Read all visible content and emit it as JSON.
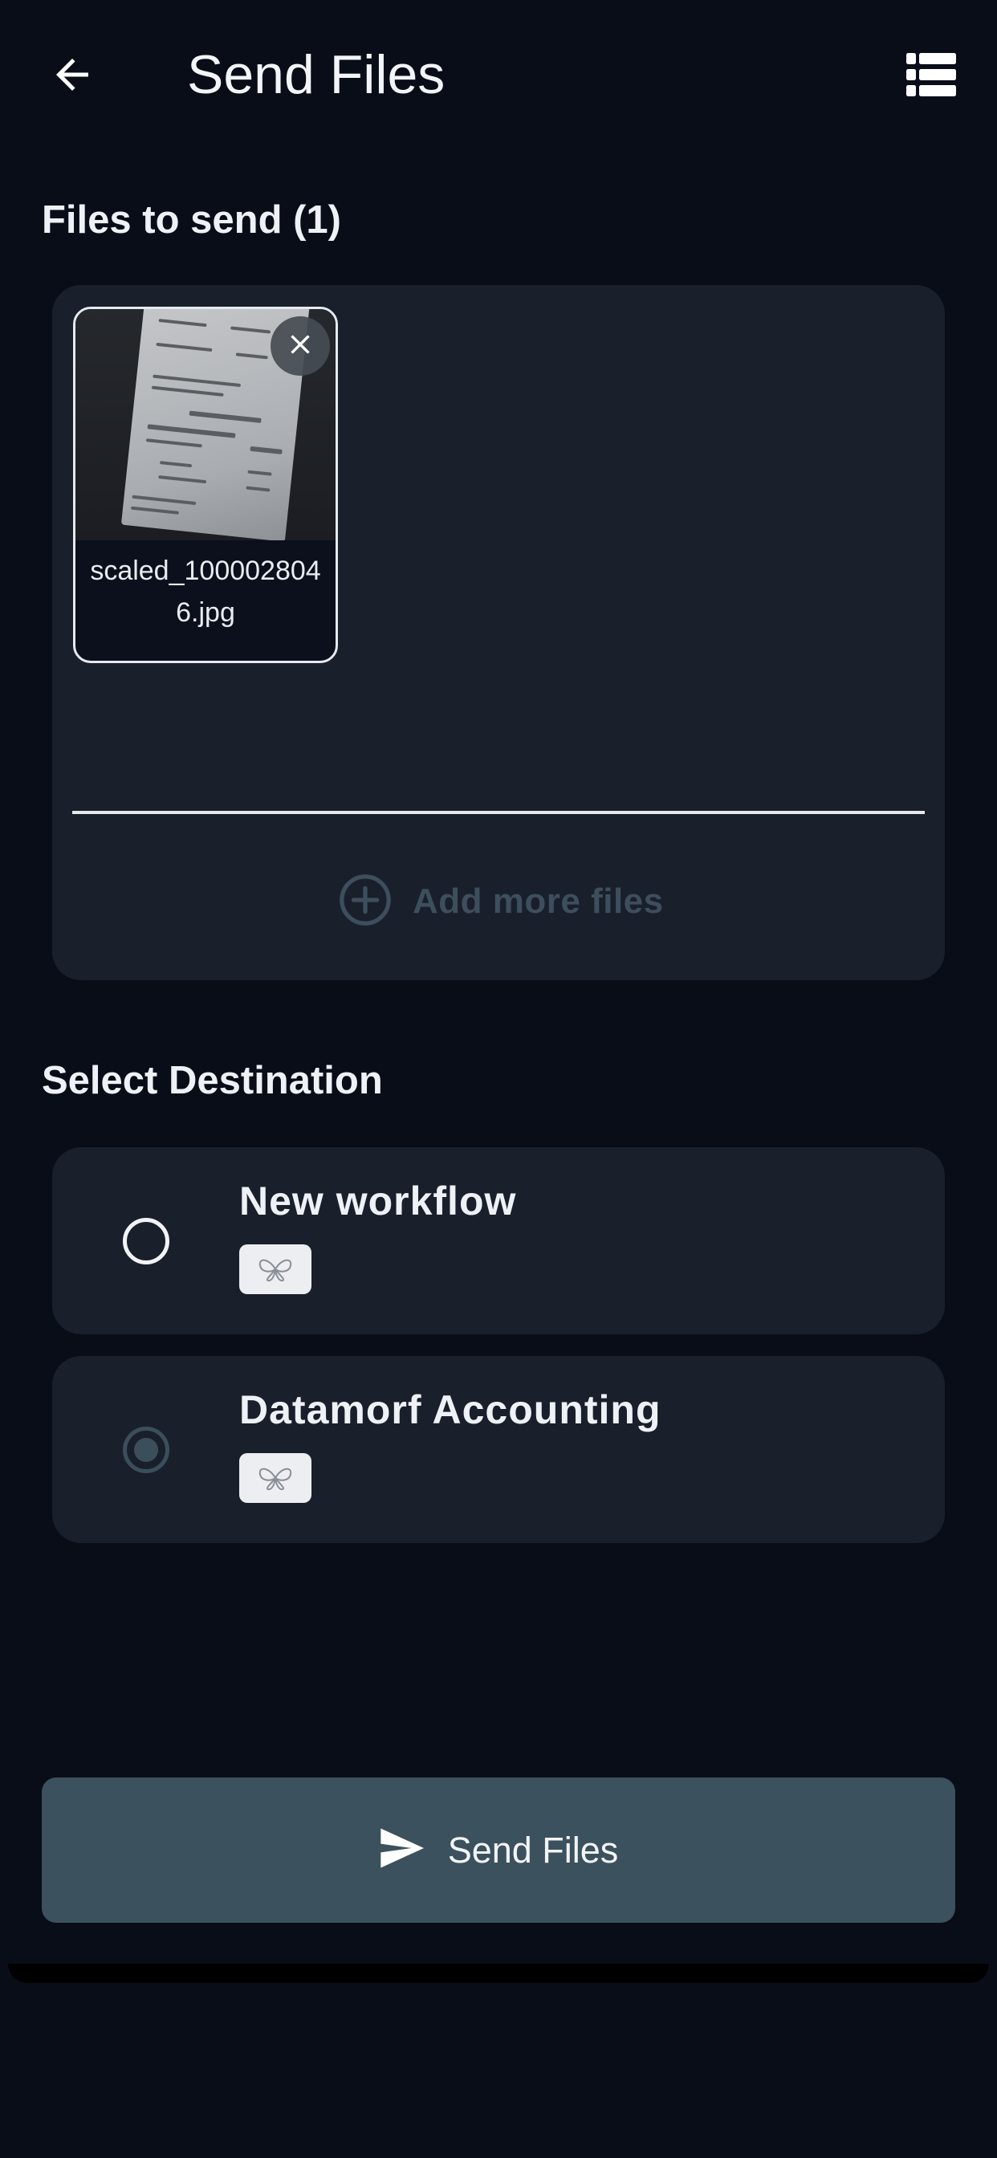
{
  "header": {
    "title": "Send Files",
    "back_icon": "arrow-left-icon",
    "menu_icon": "view-list-icon"
  },
  "files_section": {
    "heading": "Files to send (1)",
    "files": [
      {
        "name": "scaled_1000028046.jpg",
        "thumbnail": "receipt photo"
      }
    ],
    "add_more_label": "Add more files"
  },
  "destination_section": {
    "heading": "Select Destination",
    "options": [
      {
        "label": "New workflow",
        "selected": false
      },
      {
        "label": "Datamorf Accounting",
        "selected": true
      }
    ]
  },
  "send_button": {
    "label": "Send Files",
    "icon": "send-icon"
  },
  "colors": {
    "background": "#080d18",
    "card": "#1a1f2c",
    "accent": "#3b515d",
    "muted": "#3d4e5c"
  }
}
